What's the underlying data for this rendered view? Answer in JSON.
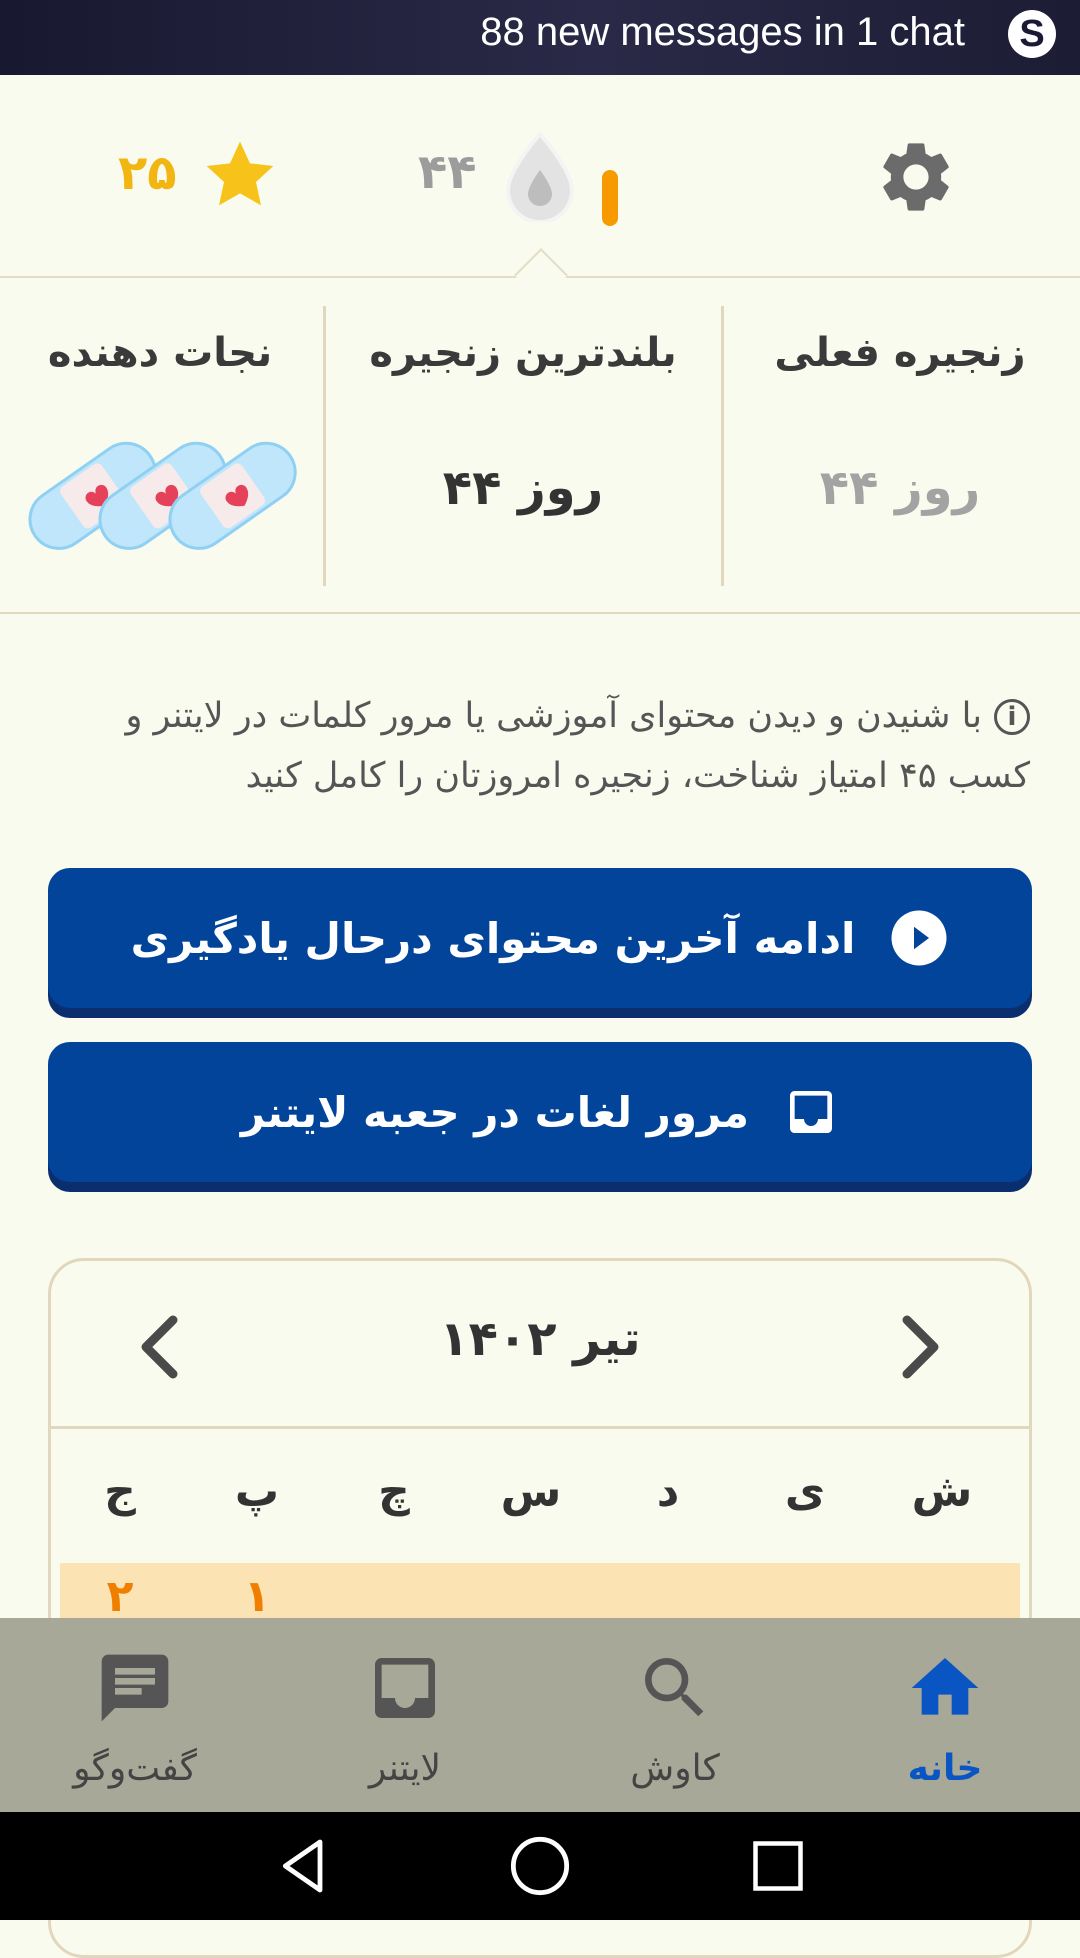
{
  "notification": {
    "text": "88 new messages in 1 chat",
    "app_icon": "skype-icon",
    "app_letter": "S"
  },
  "header": {
    "stars_value": "۲۵",
    "star_color": "#f7c31a",
    "streak_value": "۴۴",
    "streak_bar_color": "#f79a00",
    "settings_icon": "gear-icon"
  },
  "streak_panel": {
    "current_title": "زنجیره فعلی",
    "current_value": "۴۴ روز",
    "longest_title": "بلندترین زنجیره",
    "longest_value": "۴۴ روز",
    "savers_title": "نجات دهنده",
    "savers_count": 3
  },
  "info_text": "با شنیدن و دیدن محتوای آموزشی یا مرور کلمات در لایتنر و کسب ۴۵ امتیاز شناخت، زنجیره امروزتان را کامل کنید",
  "buttons": {
    "continue_label": "ادامه آخرین محتوای درحال یادگیری",
    "review_label": "مرور لغات در جعبه لایتنر",
    "primary_color": "#03449b"
  },
  "calendar": {
    "month_label": "تیر ۱۴۰۲",
    "weekdays": [
      "ش",
      "ی",
      "د",
      "س",
      "چ",
      "پ",
      "ج"
    ],
    "first_row_days": [
      "",
      "",
      "",
      "",
      "",
      "۱",
      "۲"
    ],
    "highlight_color": "#fbe3b4"
  },
  "bottom_nav": {
    "items": [
      {
        "label": "خانه",
        "icon": "home-icon",
        "active": true
      },
      {
        "label": "کاوش",
        "icon": "search-icon",
        "active": false
      },
      {
        "label": "لایتنر",
        "icon": "inbox-icon",
        "active": false
      },
      {
        "label": "گفت‌وگو",
        "icon": "chat-icon",
        "active": false
      }
    ],
    "active_color": "#0a55c4"
  }
}
